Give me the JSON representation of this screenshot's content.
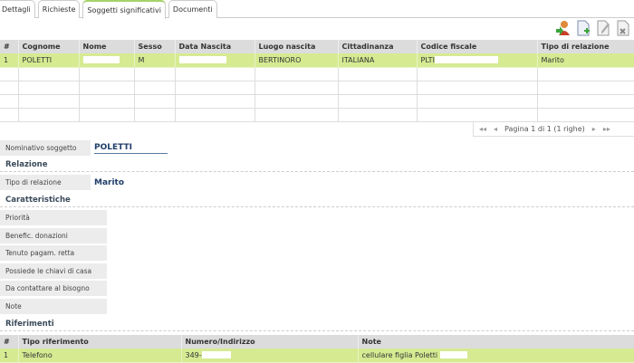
{
  "tabs": [
    "Dettagli",
    "Richieste",
    "Soggetti significativi",
    "Documenti"
  ],
  "toolbar": {
    "icons": [
      "add-person-icon",
      "new-document-icon",
      "edit-document-icon",
      "delete-document-icon"
    ]
  },
  "subjects_table": {
    "headers": [
      "#",
      "Cognome",
      "Nome",
      "Sesso",
      "Data Nascita",
      "Luogo nascita",
      "Cittadinanza",
      "Codice fiscale",
      "Tipo di relazione"
    ],
    "rows": [
      [
        "1",
        "POLETTI",
        "",
        "M",
        "",
        "BERTINORO",
        "ITALIANA",
        "PLTI",
        "Marito"
      ]
    ]
  },
  "pager": {
    "text": "Pagina 1 di 1 (1 righe)"
  },
  "detail": {
    "nominativo_label": "Nominativo soggetto",
    "nominativo_value": "POLETTI",
    "relazione_title": "Relazione",
    "tipo_label": "Tipo di relazione",
    "tipo_value": "Marito",
    "caratteristiche_title": "Caratteristiche",
    "caratteristiche": [
      "Priorità",
      "Benefic. donazioni",
      "Tenuto pagam. retta",
      "Possiede le chiavi di casa",
      "Da contattare al bisogno",
      "Note"
    ],
    "riferimenti_title": "Riferimenti"
  },
  "ref_table": {
    "headers": [
      "#",
      "Tipo riferimento",
      "Numero/Indirizzo",
      "Note"
    ],
    "rows": [
      [
        "1",
        "Telefono",
        "349-",
        "cellulare figlia Poletti"
      ]
    ]
  }
}
